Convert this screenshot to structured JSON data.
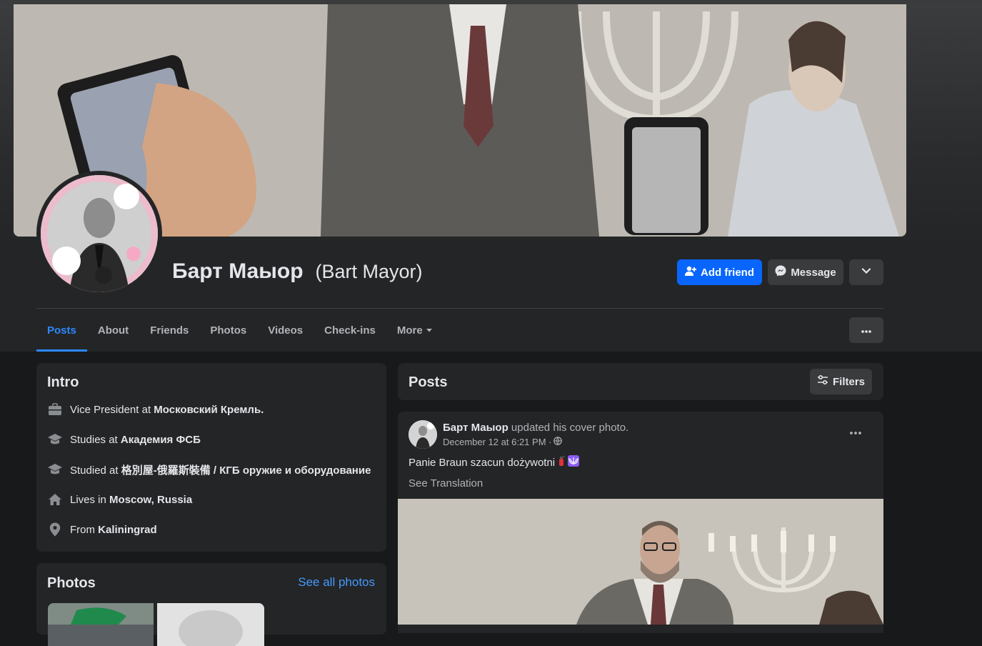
{
  "profile": {
    "name": "Барт Маыор",
    "alt_name": "(Bart Mayor)"
  },
  "actions": {
    "add_friend": "Add friend",
    "message": "Message"
  },
  "tabs": [
    {
      "label": "Posts"
    },
    {
      "label": "About"
    },
    {
      "label": "Friends"
    },
    {
      "label": "Photos"
    },
    {
      "label": "Videos"
    },
    {
      "label": "Check-ins"
    },
    {
      "label": "More"
    }
  ],
  "intro": {
    "title": "Intro",
    "items": [
      {
        "icon": "briefcase-icon",
        "prefix": "Vice President at ",
        "value": "Московский Кремль."
      },
      {
        "icon": "graduation-cap-icon",
        "prefix": "Studies at ",
        "value": "Академия ФСБ"
      },
      {
        "icon": "graduation-cap-icon",
        "prefix": "Studied at ",
        "value": "格別屋-俄羅斯裝備 / КГБ оружие и оборудование"
      },
      {
        "icon": "home-icon",
        "prefix": "Lives in ",
        "value": "Moscow, Russia"
      },
      {
        "icon": "location-pin-icon",
        "prefix": "From ",
        "value": "Kaliningrad"
      }
    ]
  },
  "photos": {
    "title": "Photos",
    "see_all": "See all photos"
  },
  "posts_header": {
    "title": "Posts",
    "filters": "Filters"
  },
  "post": {
    "author": "Барт Маыор",
    "action": " updated his cover photo.",
    "timestamp": "December 12 at 6:21 PM ·",
    "text": "Panie Braun szacun dożywotni",
    "see_translation": "See Translation"
  },
  "colors": {
    "accent": "#0866ff",
    "active_tab": "#2d88ff",
    "background": "#18191a",
    "card": "#242526"
  }
}
